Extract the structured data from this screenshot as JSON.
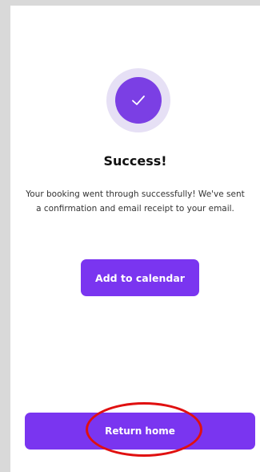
{
  "success_icon": "checkmark-icon",
  "title": "Success!",
  "message": "Your booking went through successfully! We've sent a confirmation and email receipt to your email.",
  "add_to_calendar_label": "Add to calendar",
  "return_home_label": "Return home",
  "colors": {
    "primary": "#7a35f0",
    "icon_ring": "#e6e0f5",
    "highlight": "#e01010"
  }
}
